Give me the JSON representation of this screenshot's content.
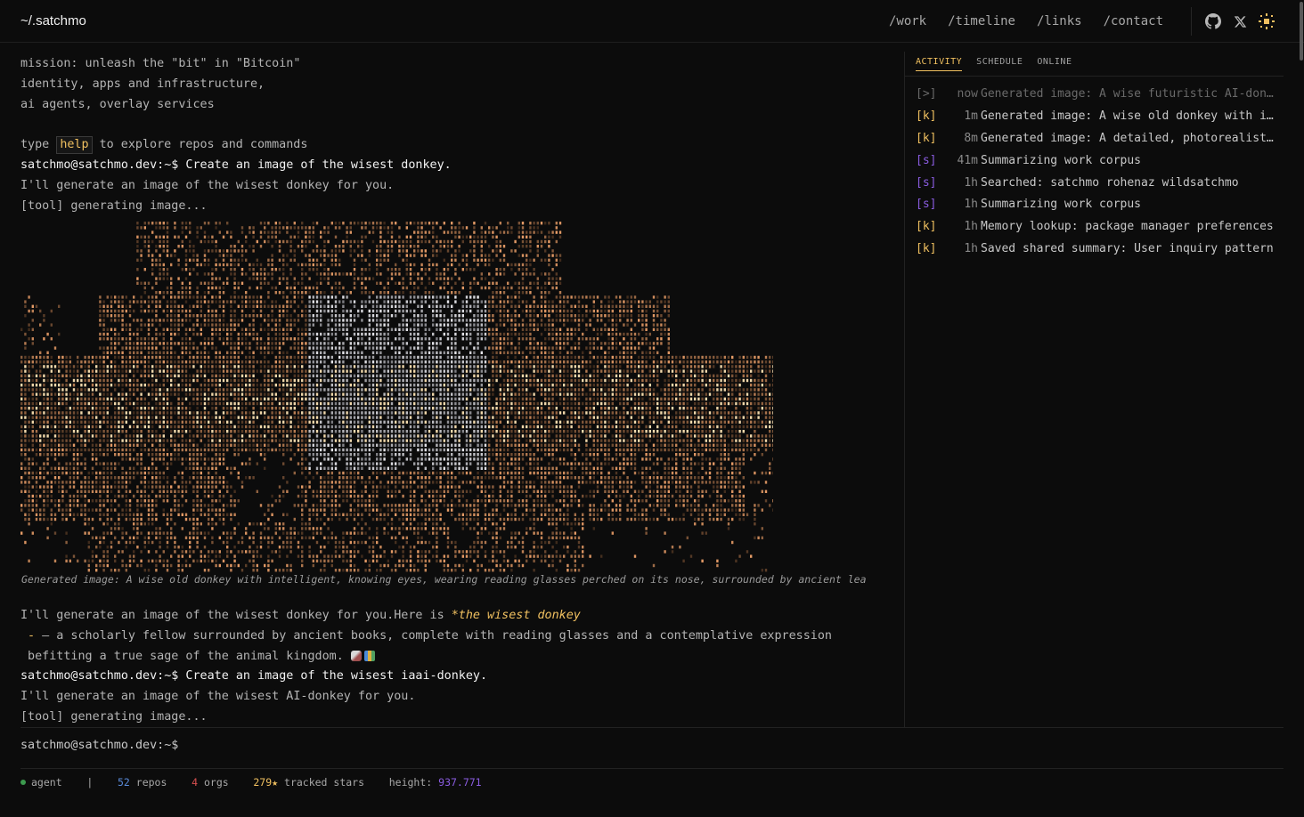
{
  "header": {
    "brand": "~/.satchmo",
    "nav": [
      "/work",
      "/timeline",
      "/links",
      "/contact"
    ],
    "icons": [
      "github-icon",
      "x-icon",
      "theme-sun-icon"
    ]
  },
  "intro": {
    "lines": [
      "mission: unleash the \"bit\" in \"Bitcoin\"",
      "identity, apps and infrastructure,",
      "ai agents, overlay services"
    ],
    "help_pre": "type ",
    "help_word": "help",
    "help_post": " to explore repos and commands"
  },
  "session": {
    "prompt1": "satchmo@satchmo.dev:~$ Create an image of the wisest donkey.",
    "reply1": "I'll generate an image of the wisest donkey for you.",
    "tool1": "[tool] generating image...",
    "caption": "Generated image: A wise old donkey with intelligent, knowing eyes, wearing reading glasses perched on its nose, surrounded by ancient lea",
    "response_pre": "I'll generate an image of the wisest donkey for you.Here is ",
    "response_em": "*the wisest donkey",
    "response_dash": " -",
    "response_line2": " — a scholarly fellow surrounded by ancient books, complete with reading glasses and a contemplative expression",
    "response_line3": " befitting a true sage of the animal kingdom. ",
    "prompt2": "satchmo@satchmo.dev:~$ Create an image of the wisest iaai-donkey.",
    "reply2": "I'll generate an image of the wisest AI-donkey for you.",
    "tool2": "[tool] generating image..."
  },
  "input_prompt": "satchmo@satchmo.dev:~$",
  "sidebar": {
    "tabs": [
      "ACTIVITY",
      "SCHEDULE",
      "ONLINE"
    ],
    "activity": [
      {
        "tag": "[>]",
        "time": "now",
        "text": "Generated image: A wise futuristic AI-donkey...",
        "kind": "n",
        "faded": true
      },
      {
        "tag": "[k]",
        "time": "1m",
        "text": "Generated image: A wise old donkey with intelligent",
        "kind": "k"
      },
      {
        "tag": "[k]",
        "time": "8m",
        "text": "Generated image: A detailed, photorealistic",
        "kind": "k"
      },
      {
        "tag": "[s]",
        "time": "41m",
        "text": "Summarizing work corpus",
        "kind": "s"
      },
      {
        "tag": "[s]",
        "time": "1h",
        "text": "Searched: satchmo rohenaz wildsatchmo",
        "kind": "s"
      },
      {
        "tag": "[s]",
        "time": "1h",
        "text": "Summarizing work corpus",
        "kind": "s"
      },
      {
        "tag": "[k]",
        "time": "1h",
        "text": "Memory lookup: package manager preferences",
        "kind": "k"
      },
      {
        "tag": "[k]",
        "time": "1h",
        "text": "Saved shared summary: User inquiry pattern",
        "kind": "k"
      }
    ]
  },
  "status": {
    "agent": "agent",
    "sep": "|",
    "repos_n": "52",
    "repos_l": "repos",
    "orgs_n": "4",
    "orgs_l": "orgs",
    "stars_n": "279★",
    "stars_l": "tracked stars",
    "height_l": "height:",
    "height_v": "937.771"
  },
  "colors": {
    "accent": "#f0c060",
    "purple": "#8a5ce0",
    "blue": "#5a8ad8",
    "red": "#d85050",
    "green": "#3c9a4e"
  }
}
